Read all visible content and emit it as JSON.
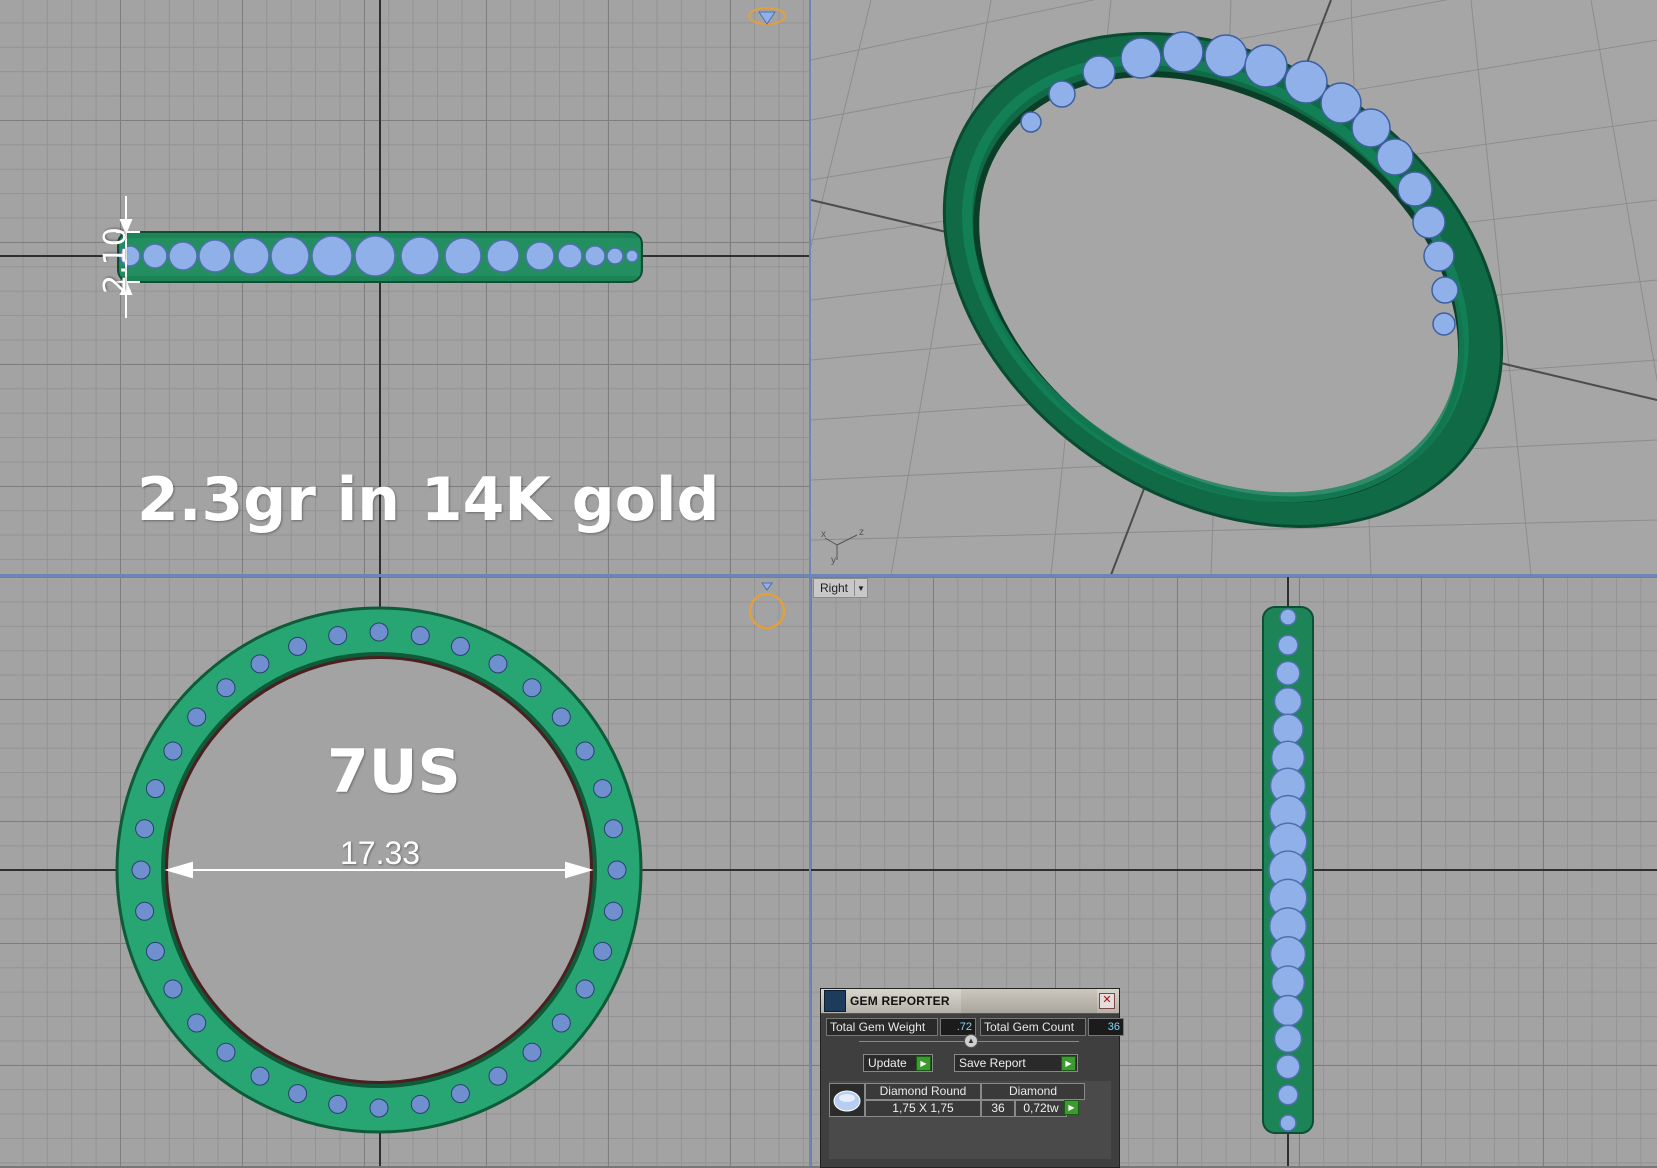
{
  "viewports": {
    "top_left": {
      "measure_height": "2.10",
      "annotation": "2.3gr in 14K gold"
    },
    "bottom_left": {
      "size_label": "7US",
      "diameter": "17.33"
    },
    "bottom_right": {
      "view_name": "Right"
    },
    "perspective": {
      "axis_x": "x",
      "axis_y": "y",
      "axis_z": "z"
    }
  },
  "colors": {
    "metal": "#1f8a5c",
    "metal_dark": "#0f5a39",
    "gem": "#8fb0e8",
    "gem_dark": "#4f6fae",
    "grid_bg": "#a3a3a3",
    "gizmo": "#e0a040"
  },
  "gem_reporter": {
    "title": "GEM REPORTER",
    "total_weight_label": "Total Gem Weight",
    "total_weight_value": ".72",
    "total_count_label": "Total Gem Count",
    "total_count_value": "36",
    "update_label": "Update",
    "save_report_label": "Save Report",
    "table": {
      "col1_header": "Diamond Round",
      "col1_value": "1,75 X 1,75",
      "col2_header": "Diamond",
      "count": "36",
      "weight": "0,72tw"
    }
  },
  "icons": [
    "diamond-gizmo-icon",
    "ring-gizmo-icon",
    "gem-reporter-icon",
    "close-icon",
    "play-icon",
    "dropdown-arrow-icon",
    "gem-thumbnail-icon"
  ]
}
